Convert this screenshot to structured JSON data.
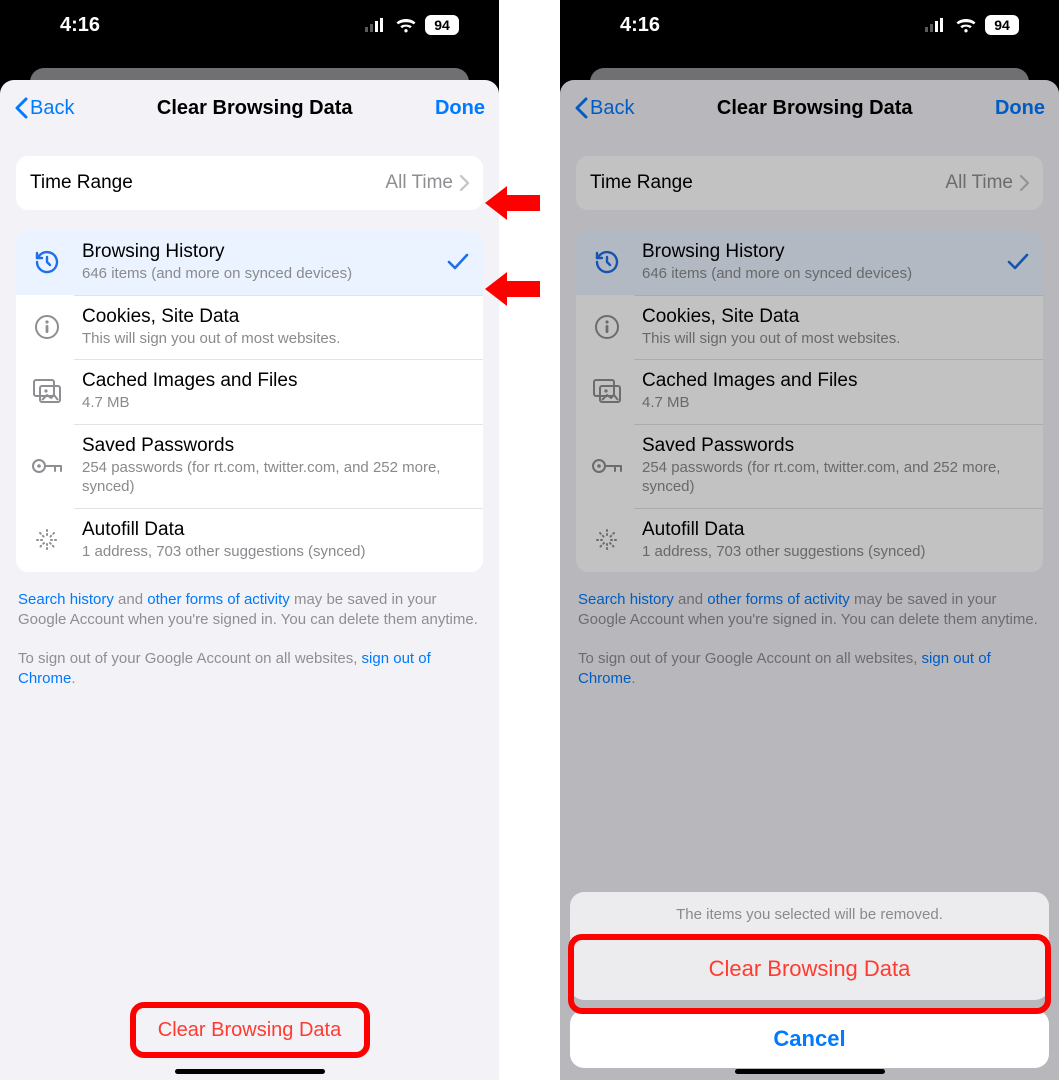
{
  "statusbar": {
    "time": "4:16",
    "battery": "94"
  },
  "nav": {
    "back": "Back",
    "title": "Clear Browsing Data",
    "done": "Done"
  },
  "time_range": {
    "label": "Time Range",
    "value": "All Time"
  },
  "items": {
    "history": {
      "title": "Browsing History",
      "sub": "646 items (and more on synced devices)"
    },
    "cookies": {
      "title": "Cookies, Site Data",
      "sub": "This will sign you out of most websites."
    },
    "cache": {
      "title": "Cached Images and Files",
      "sub": "4.7 MB"
    },
    "passwords": {
      "title": "Saved Passwords",
      "sub": "254 passwords (for rt.com, twitter.com, and 252 more, synced)"
    },
    "autofill": {
      "title": "Autofill Data",
      "sub": "1 address, 703 other suggestions (synced)"
    }
  },
  "footer": {
    "link1": "Search history",
    "mid1": " and ",
    "link2": "other forms of activity",
    "rest1": " may be saved in your Google Account when you're signed in. You can delete them anytime.",
    "lead2": "To sign out of your Google Account on all websites, ",
    "link3": "sign out of Chrome",
    "period": "."
  },
  "clear_button": "Clear Browsing Data",
  "actionsheet": {
    "message": "The items you selected will be removed.",
    "confirm": "Clear Browsing Data",
    "cancel": "Cancel"
  }
}
